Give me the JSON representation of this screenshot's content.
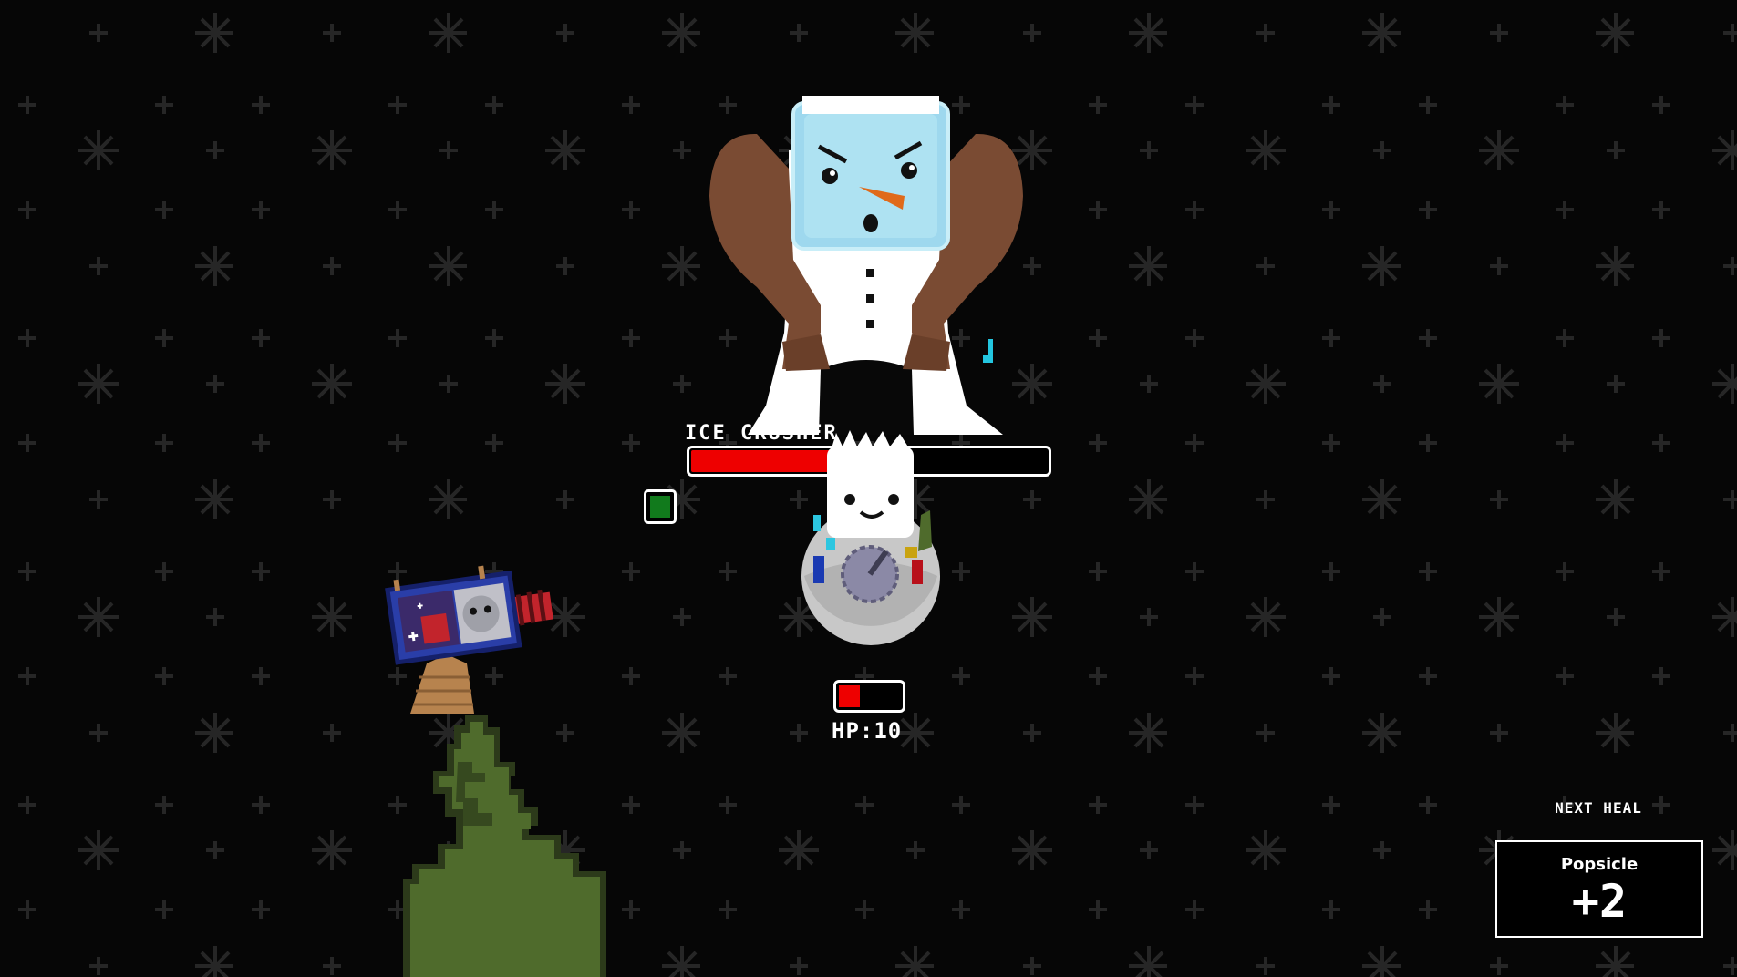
{
  "boss": {
    "name": "ICE CRUSHER",
    "health_fraction": 0.42
  },
  "player": {
    "hp_label": "HP:10",
    "health_fraction": 0.34
  },
  "next_heal": {
    "title": "NEXT HEAL",
    "item_name": "Popsicle",
    "amount": "+2"
  },
  "colors": {
    "background": "#060606",
    "snowflake": "#2a2a2a",
    "health_red": "#ee0000",
    "ice_blue": "#a7dff0",
    "boss_arm_brown": "#7a4b33",
    "tree_green": "#4f6b2c",
    "gem_green": "#117a1c"
  },
  "icons": {
    "boss": "ice-cube-snowman-boss-icon",
    "player": "snowball-character-icon",
    "turret": "candy-cannon-turret-icon",
    "tree": "pine-tree-silhouette-icon",
    "gem": "green-gem-icon"
  }
}
